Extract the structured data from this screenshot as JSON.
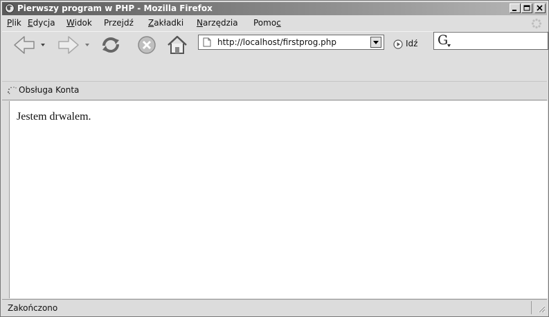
{
  "window": {
    "title": "Pierwszy program w PHP - Mozilla Firefox",
    "icons": {
      "app": "firefox-icon",
      "minimize": "minimize-icon",
      "maximize": "maximize-icon",
      "close": "close-icon"
    }
  },
  "menu": [
    {
      "pre": "",
      "u": "P",
      "post": "lik"
    },
    {
      "pre": "",
      "u": "E",
      "post": "dycja"
    },
    {
      "pre": "",
      "u": "W",
      "post": "idok"
    },
    {
      "pre": "Prze",
      "u": "j",
      "post": "dź"
    },
    {
      "pre": "",
      "u": "Z",
      "post": "akładki"
    },
    {
      "pre": "",
      "u": "N",
      "post": "arzędzia"
    },
    {
      "pre": "Pomo",
      "u": "c",
      "post": ""
    }
  ],
  "toolbar": {
    "icons": [
      "back-icon",
      "forward-icon",
      "reload-icon",
      "stop-icon",
      "home-icon"
    ],
    "url": "http://localhost/firstprog.php",
    "go_label": "Idź",
    "search_engine_letter": "G"
  },
  "bookmarks": {
    "item_label": "Obsługa Konta"
  },
  "content": {
    "text": "Jestem drwalem."
  },
  "status": {
    "text": "Zakończono"
  }
}
